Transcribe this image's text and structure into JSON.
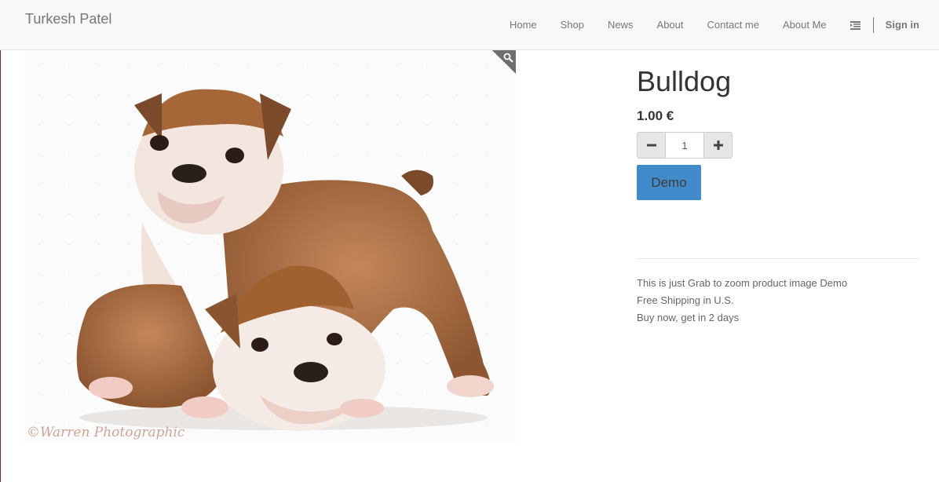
{
  "navbar": {
    "brand": "Turkesh Patel",
    "links": [
      "Home",
      "Shop",
      "News",
      "About",
      "Contact me",
      "About Me"
    ],
    "menu_icon": "list-indent-icon",
    "signin": "Sign in"
  },
  "product": {
    "image_watermark": "©Warren Photographic",
    "zoom_icon": "magnifier-icon",
    "title": "Bulldog",
    "price": "1.00 €",
    "quantity": "1",
    "demo_button": "Demo",
    "info_lines": [
      "This is just Grab to zoom product image Demo",
      "Free Shipping in U.S.",
      "Buy now, get in 2 days"
    ]
  },
  "colors": {
    "navbar_bg": "#f8f8f8",
    "primary_button": "#428bca"
  }
}
